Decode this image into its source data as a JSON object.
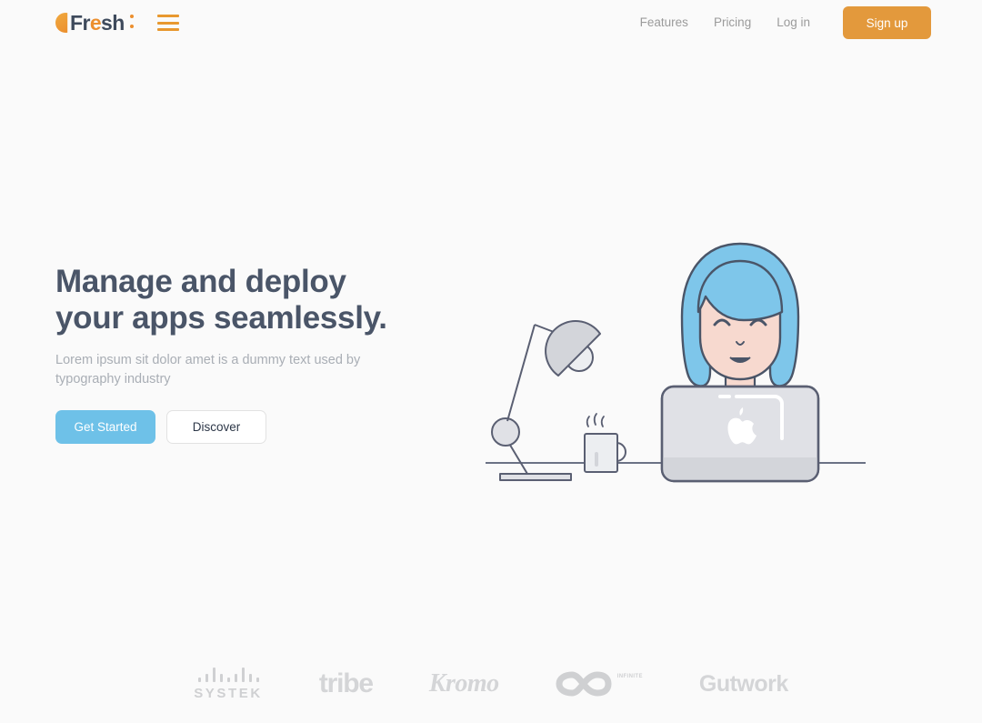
{
  "page": {
    "background_color": "#fafafa",
    "accent_orange": "#e3993c",
    "accent_blue": "#6ec1e8",
    "heading_color": "#4a5568",
    "muted_text_color": "#a9aeb5"
  },
  "header": {
    "logo": {
      "name": "Fresh",
      "part_one": "Fr",
      "highlight_letter": "e",
      "part_two": "sh",
      "mark_icon": "crescent-icon",
      "dots_icon": "colon-dots-icon"
    },
    "menu_icon": "hamburger-menu-icon",
    "nav_links": [
      {
        "label": "Features"
      },
      {
        "label": "Pricing"
      },
      {
        "label": "Log in"
      }
    ],
    "signup_label": "Sign up"
  },
  "hero": {
    "headline_line_1": "Manage and deploy",
    "headline_line_2": "your apps seamlessly.",
    "subhead": "Lorem ipsum sit dolor amet is a dummy text used by typography industry",
    "primary_cta": "Get Started",
    "secondary_cta": "Discover",
    "illustration": {
      "name": "woman-at-laptop-illustration",
      "elements": [
        "desk-lamp-icon",
        "coffee-mug-icon",
        "laptop-icon",
        "person-figure"
      ],
      "colors": {
        "hair": "#7ec6ea",
        "skin": "#f7d9cf",
        "shirt": "#343f52",
        "laptop": "#e0e1e6",
        "outline": "#5a5f72",
        "desk_line": "#6b7285"
      }
    }
  },
  "clients": {
    "logos": [
      {
        "name": "SYSTEK",
        "type": "bars-wordmark"
      },
      {
        "name": "tribe",
        "type": "wordmark"
      },
      {
        "name": "Kromo",
        "type": "script-wordmark"
      },
      {
        "name": "INFINITE",
        "type": "infinity-symbol"
      },
      {
        "name": "Gutwork",
        "type": "wordmark"
      }
    ],
    "systek_label": "SYSTEK",
    "tribe_label": "tribe",
    "kromo_label": "Kromo",
    "infinite_label": "INFINITE",
    "gutwork_label": "Gutwork"
  }
}
